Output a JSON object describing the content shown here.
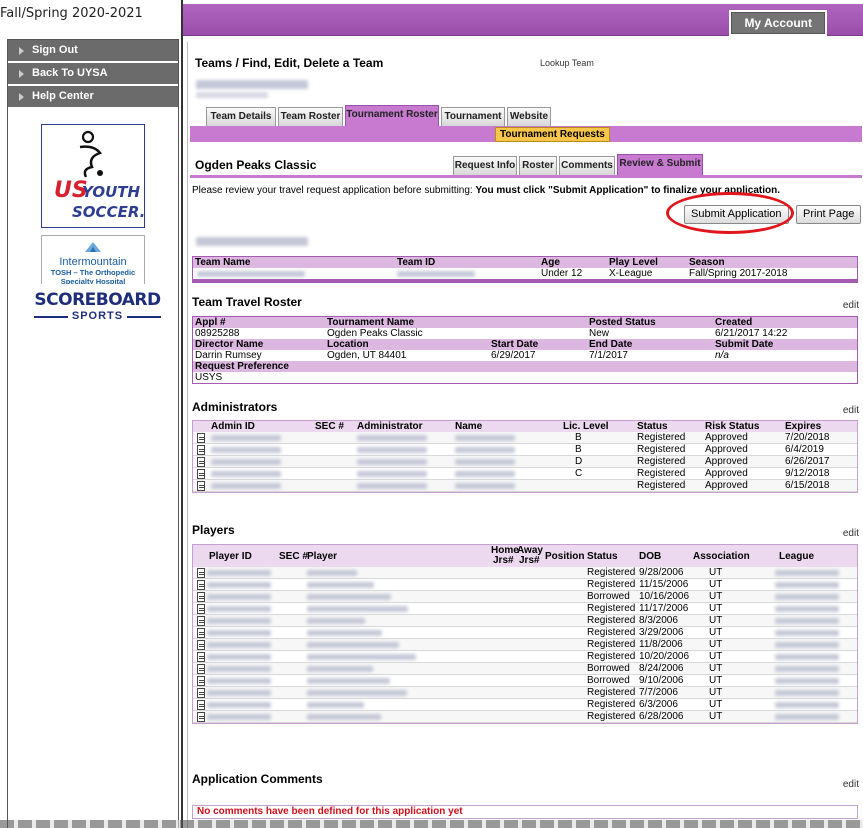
{
  "season_label": "Fall/Spring 2020-2021",
  "sidebar": {
    "links": [
      "Sign Out",
      "Back To UYSA",
      "Help Center"
    ],
    "logos": {
      "usys_line1": "US",
      "usys_line2": "YOUTH",
      "usys_line3": "SOCCER.",
      "im_line1": "Intermountain",
      "im_line2": "TOSH – The Orthopedic",
      "im_line3": "Specialty Hospital",
      "sb_line1": "SCOREBOARD",
      "sb_line2": "SPORTS"
    }
  },
  "topbar": {
    "account_label": "My Account"
  },
  "page": {
    "title": "Teams / Find, Edit, Delete a Team",
    "lookup_link": "Lookup Team"
  },
  "main_tabs": [
    "Team Details",
    "Team Roster",
    "Tournament Roster",
    "Tournament",
    "Website"
  ],
  "subtab_label": "Tournament Requests",
  "tournament_name": "Ogden Peaks Classic",
  "request_tabs": [
    "Request Info",
    "Roster",
    "Comments",
    "Review & Submit"
  ],
  "instructions": {
    "plain": "Please review your travel request application before submitting: ",
    "bold": "You must click \"Submit Application\" to finalize your application."
  },
  "buttons": {
    "submit": "Submit Application",
    "print": "Print Page"
  },
  "team_table": {
    "headers": [
      "Team Name",
      "Team ID",
      "Age",
      "Play Level",
      "Season"
    ],
    "age": "Under 12",
    "play_level": "X-League",
    "season": "Fall/Spring 2017-2018"
  },
  "travel_roster": {
    "title": "Team Travel Roster",
    "edit": "edit",
    "row1_headers": [
      "Appl #",
      "Tournament Name",
      "Posted Status",
      "Created"
    ],
    "row1_values": [
      "08925288",
      "Ogden Peaks Classic",
      "New",
      "6/21/2017 14:22"
    ],
    "row2_headers": [
      "Director Name",
      "Location",
      "Start Date",
      "End Date",
      "Submit Date"
    ],
    "row2_values": [
      "Darrin Rumsey",
      "Ogden, UT 84401",
      "6/29/2017",
      "7/1/2017",
      "n/a"
    ],
    "row3_header": "Request Preference",
    "row3_value": "USYS"
  },
  "administrators": {
    "title": "Administrators",
    "edit": "edit",
    "headers": [
      "Admin ID",
      "SEC #",
      "Administrator",
      "Name",
      "Lic. Level",
      "Status",
      "Risk Status",
      "Expires"
    ],
    "rows": [
      {
        "lic": "B",
        "status": "Registered",
        "risk": "Approved",
        "expires": "7/20/2018"
      },
      {
        "lic": "B",
        "status": "Registered",
        "risk": "Approved",
        "expires": "6/4/2019"
      },
      {
        "lic": "D",
        "status": "Registered",
        "risk": "Approved",
        "expires": "6/26/2017"
      },
      {
        "lic": "C",
        "status": "Registered",
        "risk": "Approved",
        "expires": "9/12/2018"
      },
      {
        "lic": "",
        "status": "Registered",
        "risk": "Approved",
        "expires": "6/15/2018"
      }
    ]
  },
  "players": {
    "title": "Players",
    "edit": "edit",
    "headers": {
      "player_id": "Player ID",
      "sec": "SEC #",
      "player": "Player",
      "home_top": "Home",
      "home_bottom": "Jrs#",
      "away_top": "Away",
      "away_bottom": "Jrs#",
      "position": "Position",
      "status": "Status",
      "dob": "DOB",
      "association": "Association",
      "league": "League"
    },
    "rows": [
      {
        "status": "Registered",
        "dob": "9/28/2006",
        "assoc": "UT"
      },
      {
        "status": "Registered",
        "dob": "11/15/2006",
        "assoc": "UT"
      },
      {
        "status": "Borrowed",
        "dob": "10/16/2006",
        "assoc": "UT"
      },
      {
        "status": "Registered",
        "dob": "11/17/2006",
        "assoc": "UT"
      },
      {
        "status": "Registered",
        "dob": "8/3/2006",
        "assoc": "UT"
      },
      {
        "status": "Registered",
        "dob": "3/29/2006",
        "assoc": "UT"
      },
      {
        "status": "Registered",
        "dob": "11/8/2006",
        "assoc": "UT"
      },
      {
        "status": "Registered",
        "dob": "10/20/2006",
        "assoc": "UT"
      },
      {
        "status": "Borrowed",
        "dob": "8/24/2006",
        "assoc": "UT"
      },
      {
        "status": "Borrowed",
        "dob": "9/10/2006",
        "assoc": "UT"
      },
      {
        "status": "Registered",
        "dob": "7/7/2006",
        "assoc": "UT"
      },
      {
        "status": "Registered",
        "dob": "6/3/2006",
        "assoc": "UT"
      },
      {
        "status": "Registered",
        "dob": "6/28/2006",
        "assoc": "UT"
      }
    ]
  },
  "comments": {
    "title": "Application Comments",
    "edit": "edit",
    "empty_message": "No comments have been defined for this application yet"
  }
}
